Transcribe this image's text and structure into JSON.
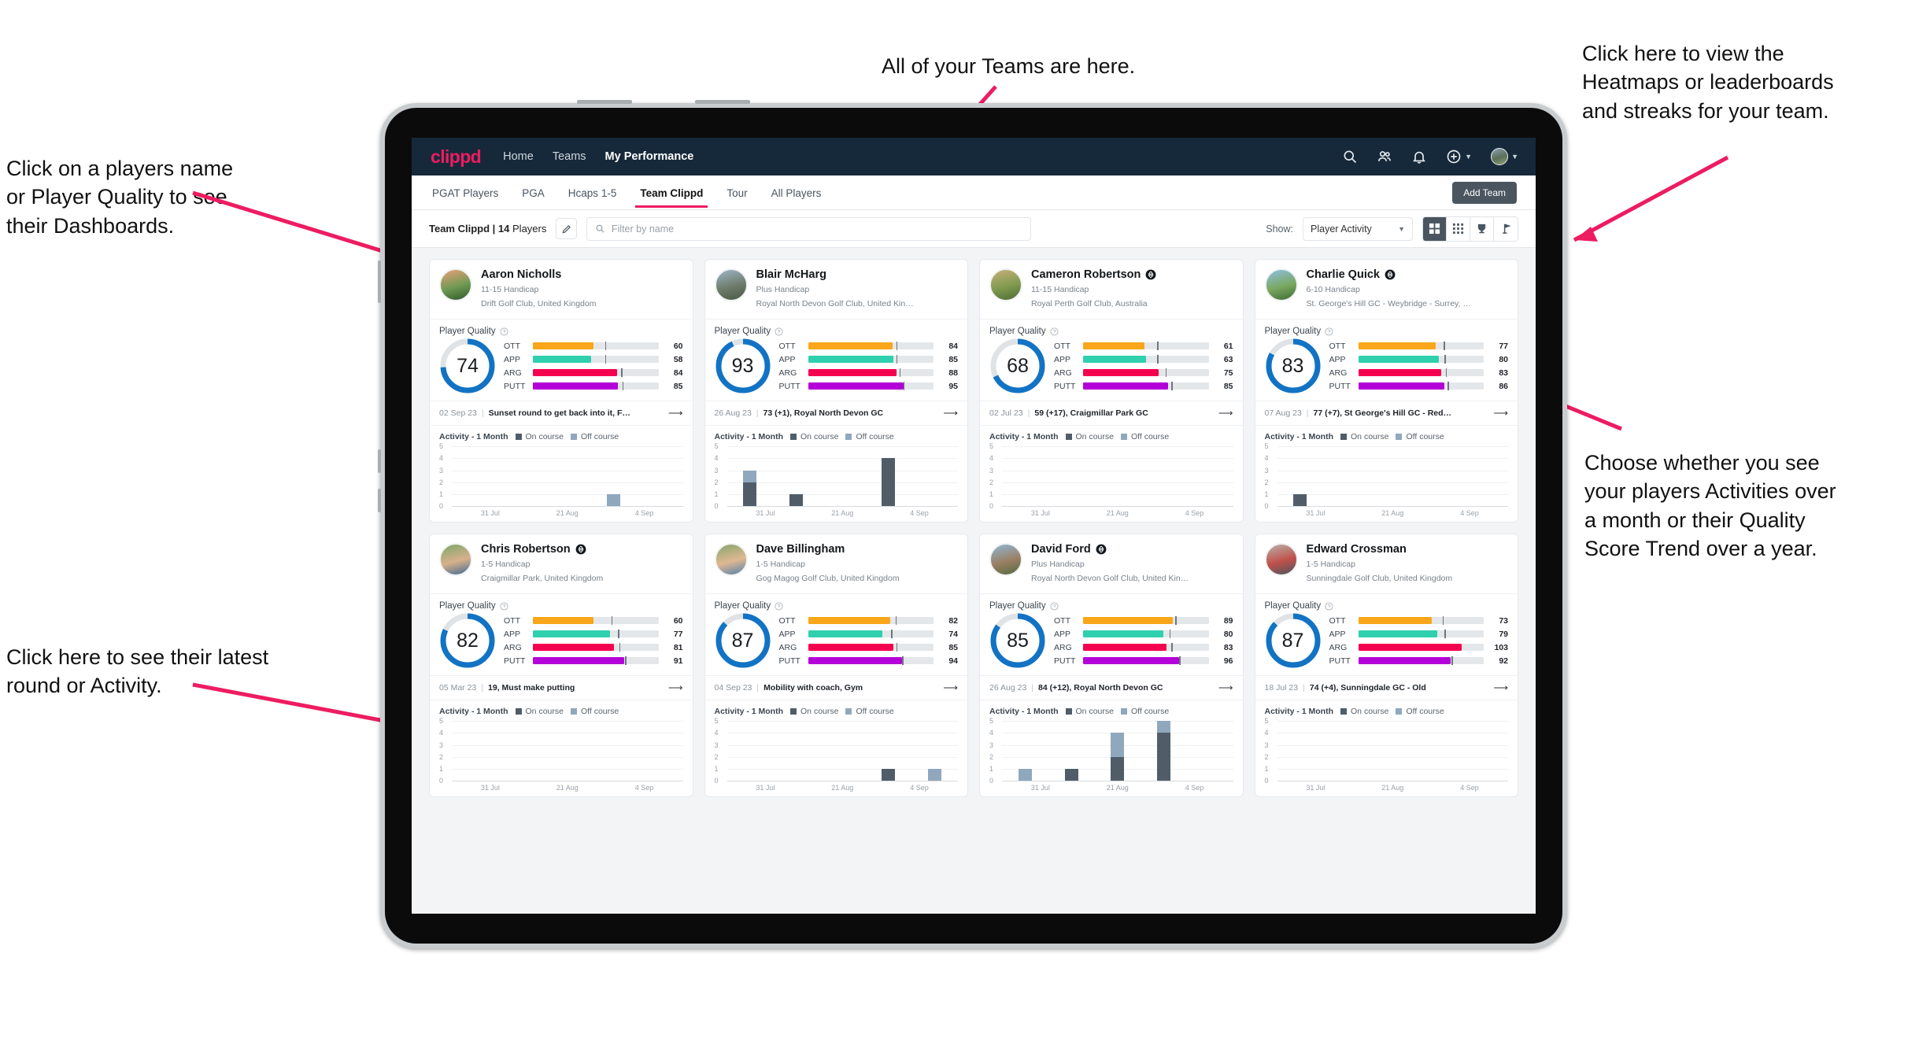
{
  "annotations": [
    {
      "id": "a-teams",
      "text": "All of your Teams are here."
    },
    {
      "id": "a-heatmaps",
      "text": "Click here to view the\nHeatmaps or leaderboards\nand streaks for your team."
    },
    {
      "id": "a-names",
      "text": "Click on a players name\nor Player Quality to see\ntheir Dashboards."
    },
    {
      "id": "a-activity",
      "text": "Choose whether you see\nyour players Activities over\na month or their Quality\nScore Trend over a year."
    },
    {
      "id": "a-latest",
      "text": "Click here to see their latest\nround or Activity."
    }
  ],
  "topnav": {
    "brand": "clippd",
    "links": [
      {
        "label": "Home",
        "active": false
      },
      {
        "label": "Teams",
        "active": false
      },
      {
        "label": "My Performance",
        "active": true
      }
    ],
    "icons": [
      "search-icon",
      "people-icon",
      "bell-icon",
      "plus-circle-icon",
      "avatar"
    ]
  },
  "tabs": [
    {
      "label": "PGAT Players",
      "active": false
    },
    {
      "label": "PGA",
      "active": false
    },
    {
      "label": "Hcaps 1-5",
      "active": false
    },
    {
      "label": "Team Clippd",
      "active": true
    },
    {
      "label": "Tour",
      "active": false
    },
    {
      "label": "All Players",
      "active": false
    }
  ],
  "add_team_label": "Add Team",
  "toolbar": {
    "team_name": "Team Clippd",
    "team_count": "14",
    "team_suffix": "Players",
    "search_placeholder": "Filter by name",
    "search_value": "",
    "show_label": "Show:",
    "show_value": "Player Activity",
    "show_options": [
      "Player Activity",
      "Quality Score Trend"
    ],
    "views": [
      {
        "name": "grid-view-icon",
        "active": true
      },
      {
        "name": "dots-grid-view-icon",
        "active": false
      },
      {
        "name": "trophy-view-icon",
        "active": false
      },
      {
        "name": "flag-view-icon",
        "active": false
      }
    ]
  },
  "card_labels": {
    "player_quality": "Player Quality",
    "activity": "Activity - 1 Month",
    "legend_on": "On course",
    "legend_off": "Off course",
    "y_ticks": [
      "5",
      "4",
      "3",
      "2",
      "1",
      "0"
    ],
    "x_ticks": [
      "31 Jul",
      "21 Aug",
      "4 Sep"
    ]
  },
  "colors": {
    "brand": "#ed1c61",
    "navbar": "#16293a",
    "ring": "#1273c4",
    "ott": "#f9a61a",
    "app": "#2fd0ad",
    "arg": "#f5004e",
    "putt": "#b400d8",
    "on_course": "#505d69",
    "off_course": "#8fa8bd"
  },
  "players": [
    {
      "name": "Aaron Nicholls",
      "verified": false,
      "handicap": "11-15 Handicap",
      "club": "Drift Golf Club, United Kingdom",
      "quality": 74,
      "avatar": [
        "#e9a07a",
        "#6f9a52",
        "#2f5a2b"
      ],
      "metrics": [
        {
          "label": "OTT",
          "value": 60,
          "tick": 72
        },
        {
          "label": "APP",
          "value": 58,
          "tick": 72
        },
        {
          "label": "ARG",
          "value": 84,
          "tick": 88
        },
        {
          "label": "PUTT",
          "value": 85,
          "tick": 89
        }
      ],
      "latest_date": "02 Sep 23",
      "latest_text": "Sunset round to get back into it, F…",
      "chart": {
        "type": "bar",
        "on": [
          0,
          0,
          0,
          0,
          0
        ],
        "off": [
          0,
          0,
          0,
          1,
          0
        ]
      }
    },
    {
      "name": "Blair McHarg",
      "verified": false,
      "handicap": "Plus Handicap",
      "club": "Royal North Devon Golf Club, United Kin…",
      "quality": 93,
      "avatar": [
        "#9fb7c9",
        "#6d7b6a",
        "#4a5a46"
      ],
      "metrics": [
        {
          "label": "OTT",
          "value": 84,
          "tick": 88
        },
        {
          "label": "APP",
          "value": 85,
          "tick": 88
        },
        {
          "label": "ARG",
          "value": 88,
          "tick": 91
        },
        {
          "label": "PUTT",
          "value": 95,
          "tick": 95
        }
      ],
      "latest_date": "26 Aug 23",
      "latest_text": "73 (+1), Royal North Devon GC",
      "chart": {
        "type": "bar",
        "on": [
          2,
          1,
          0,
          4,
          0
        ],
        "off": [
          1,
          0,
          0,
          0,
          0
        ]
      }
    },
    {
      "name": "Cameron Robertson",
      "verified": true,
      "handicap": "11-15 Handicap",
      "club": "Royal Perth Golf Club, Australia",
      "quality": 68,
      "avatar": [
        "#c9b07c",
        "#7f9a4e",
        "#4d6b33"
      ],
      "metrics": [
        {
          "label": "OTT",
          "value": 61,
          "tick": 74
        },
        {
          "label": "APP",
          "value": 63,
          "tick": 74
        },
        {
          "label": "ARG",
          "value": 75,
          "tick": 82
        },
        {
          "label": "PUTT",
          "value": 85,
          "tick": 88
        }
      ],
      "latest_date": "02 Jul 23",
      "latest_text": "59 (+17), Craigmillar Park GC",
      "chart": {
        "type": "bar",
        "on": [
          0,
          0,
          0,
          0,
          0
        ],
        "off": [
          0,
          0,
          0,
          0,
          0
        ]
      }
    },
    {
      "name": "Charlie Quick",
      "verified": true,
      "handicap": "6-10 Handicap",
      "club": "St. George's Hill GC - Weybridge - Surrey, …",
      "quality": 83,
      "avatar": [
        "#8fc0e3",
        "#79a85f",
        "#3f6b34"
      ],
      "metrics": [
        {
          "label": "OTT",
          "value": 77,
          "tick": 85
        },
        {
          "label": "APP",
          "value": 80,
          "tick": 86
        },
        {
          "label": "ARG",
          "value": 83,
          "tick": 87
        },
        {
          "label": "PUTT",
          "value": 86,
          "tick": 89
        }
      ],
      "latest_date": "07 Aug 23",
      "latest_text": "77 (+7), St George's Hill GC - Red…",
      "chart": {
        "type": "bar",
        "on": [
          1,
          0,
          0,
          0,
          0
        ],
        "off": [
          0,
          0,
          0,
          0,
          0
        ]
      }
    },
    {
      "name": "Chris Robertson",
      "verified": true,
      "handicap": "1-5 Handicap",
      "club": "Craigmillar Park, United Kingdom",
      "quality": 82,
      "avatar": [
        "#7fa86a",
        "#d8b08c",
        "#3c6a8f"
      ],
      "metrics": [
        {
          "label": "OTT",
          "value": 60,
          "tick": 78
        },
        {
          "label": "APP",
          "value": 77,
          "tick": 85
        },
        {
          "label": "ARG",
          "value": 81,
          "tick": 86
        },
        {
          "label": "PUTT",
          "value": 91,
          "tick": 92
        }
      ],
      "latest_date": "05 Mar 23",
      "latest_text": "19, Must make putting",
      "chart": {
        "type": "bar",
        "on": [
          0,
          0,
          0,
          0,
          0
        ],
        "off": [
          0,
          0,
          0,
          0,
          0
        ]
      }
    },
    {
      "name": "Dave Billingham",
      "verified": false,
      "handicap": "1-5 Handicap",
      "club": "Gog Magog Golf Club, United Kingdom",
      "quality": 87,
      "avatar": [
        "#86a56c",
        "#e0b892",
        "#4e7fa8"
      ],
      "metrics": [
        {
          "label": "OTT",
          "value": 82,
          "tick": 87
        },
        {
          "label": "APP",
          "value": 74,
          "tick": 83
        },
        {
          "label": "ARG",
          "value": 85,
          "tick": 88
        },
        {
          "label": "PUTT",
          "value": 94,
          "tick": 94
        }
      ],
      "latest_date": "04 Sep 23",
      "latest_text": "Mobility with coach, Gym",
      "chart": {
        "type": "bar",
        "on": [
          0,
          0,
          0,
          1,
          0
        ],
        "off": [
          0,
          0,
          0,
          0,
          1
        ]
      }
    },
    {
      "name": "David Ford",
      "verified": true,
      "handicap": "Plus Handicap",
      "club": "Royal North Devon Golf Club, United Kin…",
      "quality": 85,
      "avatar": [
        "#8fb8d4",
        "#9a7f63",
        "#556b3f"
      ],
      "metrics": [
        {
          "label": "OTT",
          "value": 89,
          "tick": 92
        },
        {
          "label": "APP",
          "value": 80,
          "tick": 86
        },
        {
          "label": "ARG",
          "value": 83,
          "tick": 88
        },
        {
          "label": "PUTT",
          "value": 96,
          "tick": 96
        }
      ],
      "latest_date": "26 Aug 23",
      "latest_text": "84 (+12), Royal North Devon GC",
      "chart": {
        "type": "bar",
        "on": [
          0,
          1,
          2,
          4,
          0
        ],
        "off": [
          1,
          0,
          2,
          1,
          0
        ]
      }
    },
    {
      "name": "Edward Crossman",
      "verified": false,
      "handicap": "1-5 Handicap",
      "club": "Sunningdale Golf Club, United Kingdom",
      "quality": 87,
      "avatar": [
        "#b8b2a8",
        "#c0504a",
        "#4a5560"
      ],
      "metrics": [
        {
          "label": "OTT",
          "value": 73,
          "tick": 84
        },
        {
          "label": "APP",
          "value": 79,
          "tick": 86
        },
        {
          "label": "ARG",
          "value": 103,
          "tick": 0
        },
        {
          "label": "PUTT",
          "value": 92,
          "tick": 93
        }
      ],
      "latest_date": "18 Jul 23",
      "latest_text": "74 (+4), Sunningdale GC - Old",
      "chart": {
        "type": "bar",
        "on": [
          0,
          0,
          0,
          0,
          0
        ],
        "off": [
          0,
          0,
          0,
          0,
          0
        ]
      }
    }
  ]
}
